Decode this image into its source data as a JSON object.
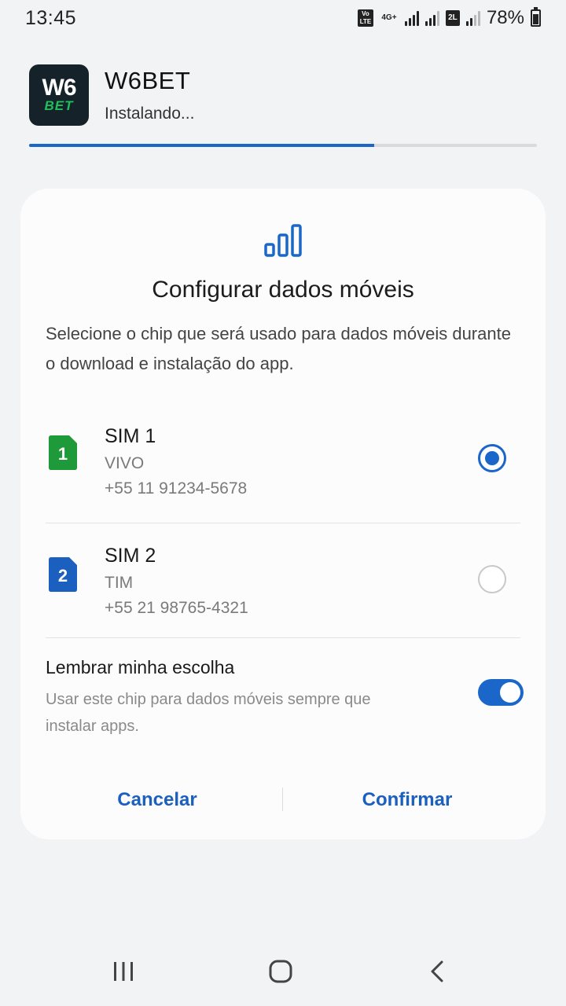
{
  "status_bar": {
    "time": "13:45",
    "volte": "Vo LTE",
    "network": "4G+",
    "sim_badge": "2L",
    "battery": "78%"
  },
  "app": {
    "logo_top": "W6",
    "logo_bottom": "BET",
    "name": "W6BET",
    "status": "Instalando...",
    "progress": 0.68
  },
  "dialog": {
    "icon": "mobile-data-signal-icon",
    "title": "Configurar dados móveis",
    "description": "Selecione o chip que será usado para dados móveis durante o download e instalação do app.",
    "sims": [
      {
        "slot": "1",
        "name": "SIM 1",
        "carrier": "VIVO",
        "number": "+55 11 91234-5678",
        "selected": true,
        "color": "#1e9a3a"
      },
      {
        "slot": "2",
        "name": "SIM 2",
        "carrier": "TIM",
        "number": "+55 21 98765-4321",
        "selected": false,
        "color": "#1b5fbf"
      }
    ],
    "remember": {
      "title": "Lembrar minha escolha",
      "description": "Usar este chip para dados móveis sempre que instalar apps.",
      "enabled": true
    },
    "cancel_label": "Cancelar",
    "confirm_label": "Confirmar"
  },
  "colors": {
    "accent": "#1b66c9",
    "background": "#f2f3f5",
    "dialog": "#fcfcfd"
  }
}
